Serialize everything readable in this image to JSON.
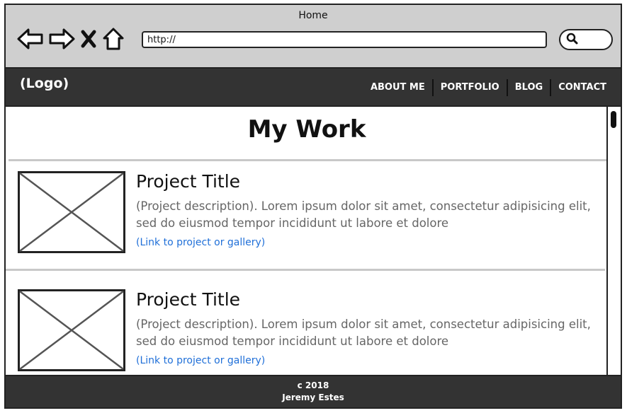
{
  "window": {
    "title": "Home"
  },
  "browser": {
    "url_value": "http://",
    "search_placeholder": ""
  },
  "header": {
    "logo": "(Logo)",
    "nav": [
      "ABOUT ME",
      "PORTFOLIO",
      "BLOG",
      "CONTACT"
    ]
  },
  "page": {
    "title": "My Work",
    "projects": [
      {
        "title": "Project Title",
        "description": "(Project description). Lorem ipsum dolor sit amet, consectetur adipisicing elit, sed do eiusmod tempor incididunt ut labore et dolore",
        "link": "(Link to project or gallery)"
      },
      {
        "title": "Project Title",
        "description": "(Project description). Lorem ipsum dolor sit amet, consectetur adipisicing elit, sed do eiusmod tempor incididunt ut labore et dolore",
        "link": "(Link to project or gallery)"
      }
    ]
  },
  "footer": {
    "copyright": "c 2018",
    "author": "Jeremy Estes"
  },
  "colors": {
    "chrome": "#cfcfcf",
    "header": "#333333",
    "link": "#1f6fd8",
    "description": "#666666"
  },
  "icons": [
    "back-arrow-icon",
    "forward-arrow-icon",
    "close-icon",
    "home-icon",
    "search-icon",
    "image-placeholder-icon"
  ]
}
